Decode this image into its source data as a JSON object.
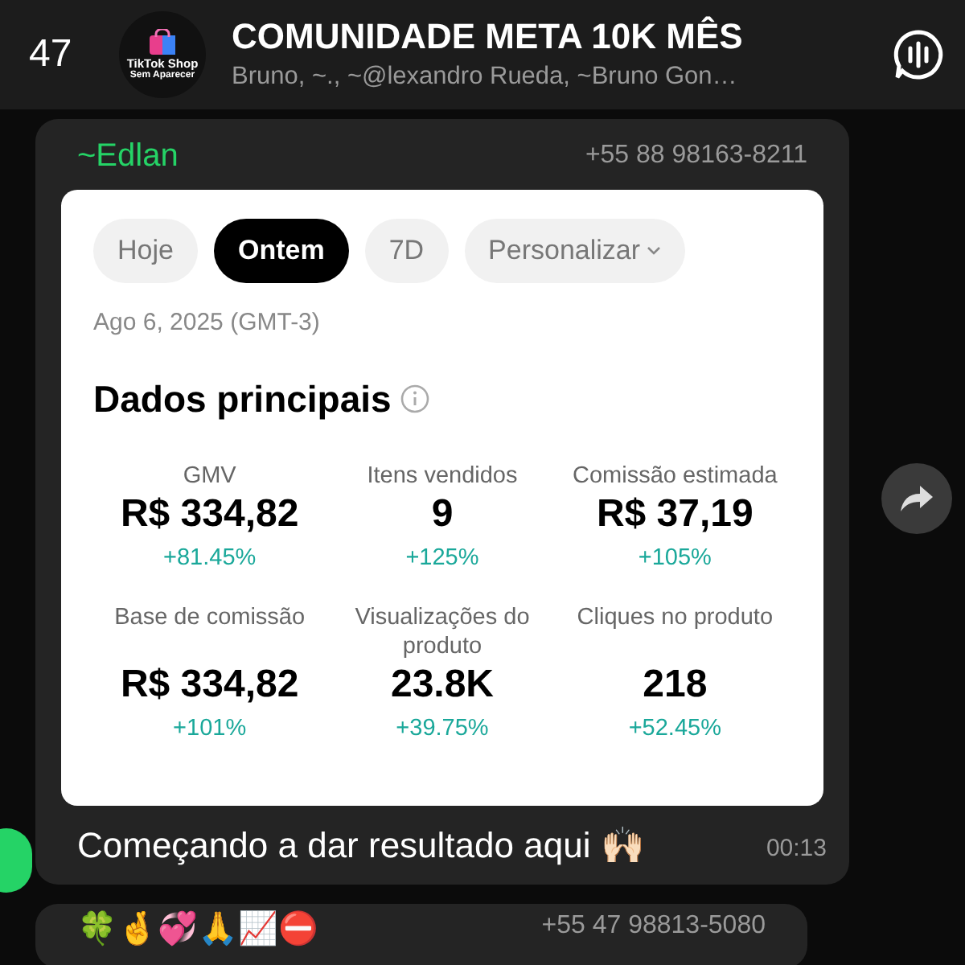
{
  "header": {
    "unread_count": "47",
    "avatar_text": [
      "TikTok Shop",
      "Sem Aparecer"
    ],
    "title": "COMUNIDADE META 10K MÊS",
    "members": "Bruno, ~., ~@lexandro Rueda, ~Bruno Gon…"
  },
  "message": {
    "sender": "~Edlan",
    "phone": "+55 88 98163-8211",
    "screenshot": {
      "filters": [
        {
          "label": "Hoje",
          "selected": false,
          "dropdown": false
        },
        {
          "label": "Ontem",
          "selected": true,
          "dropdown": false
        },
        {
          "label": "7D",
          "selected": false,
          "dropdown": false
        },
        {
          "label": "Personalizar",
          "selected": false,
          "dropdown": true
        }
      ],
      "date": "Ago 6, 2025 (GMT-3)",
      "section_title": "Dados principais",
      "metrics": [
        {
          "label": "GMV",
          "value": "R$ 334,82",
          "change": "+81.45%"
        },
        {
          "label": "Itens vendidos",
          "value": "9",
          "change": "+125%"
        },
        {
          "label": "Comissão estimada",
          "value": "R$ 37,19",
          "change": "+105%"
        },
        {
          "label": "Base de comissão",
          "value": "R$ 334,82",
          "change": "+101%"
        },
        {
          "label": "Visualizações do produto",
          "value": "23.8K",
          "change": "+39.75%"
        },
        {
          "label": "Cliques no produto",
          "value": "218",
          "change": "+52.45%"
        }
      ]
    },
    "caption": "Começando a dar resultado aqui 🙌🏻",
    "time": "00:13"
  },
  "next_message": {
    "text": "🍀🤞💞🙏📈⛔",
    "phone": "+55 47 98813-5080"
  }
}
